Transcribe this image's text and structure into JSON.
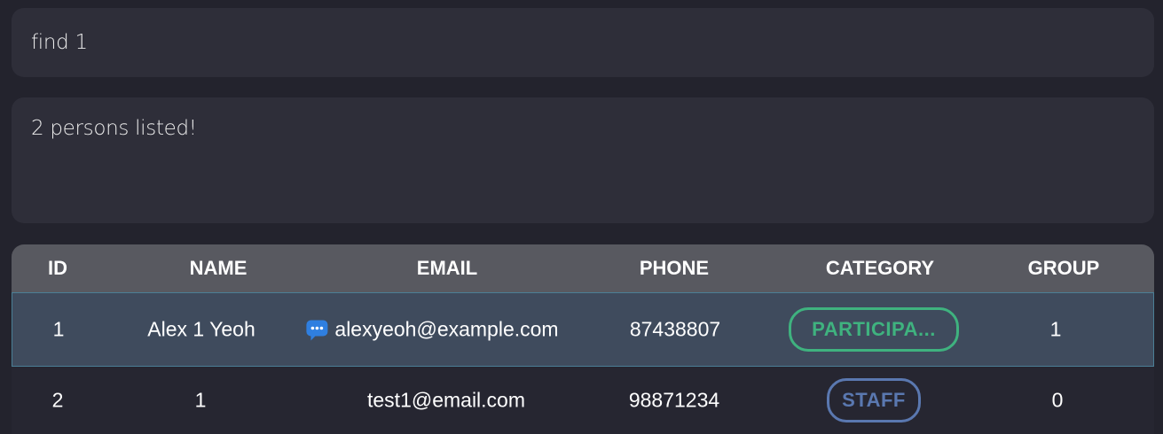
{
  "command": {
    "text": "find 1"
  },
  "result": {
    "text": "2 persons listed!"
  },
  "table": {
    "headers": {
      "id": "ID",
      "name": "NAME",
      "email": "EMAIL",
      "phone": "PHONE",
      "category": "CATEGORY",
      "group": "GROUP"
    },
    "rows": [
      {
        "id": "1",
        "name": "Alex 1 Yeoh",
        "email": "alexyeoh@example.com",
        "email_icon": "chat-bubble-icon",
        "phone": "87438807",
        "category": "PARTICIPA...",
        "group": "1",
        "selected": true
      },
      {
        "id": "2",
        "name": "1",
        "email": "test1@email.com",
        "phone": "98871234",
        "category": "STAFF",
        "group": "0",
        "selected": false
      }
    ]
  },
  "colors": {
    "background": "#23232d",
    "panel": "#2e2e39",
    "header": "#585960",
    "selected_row": "#3f4b5d",
    "participant_badge": "#3fb27f",
    "staff_badge": "#5a78b0",
    "chat_icon": "#2f7fe0"
  }
}
